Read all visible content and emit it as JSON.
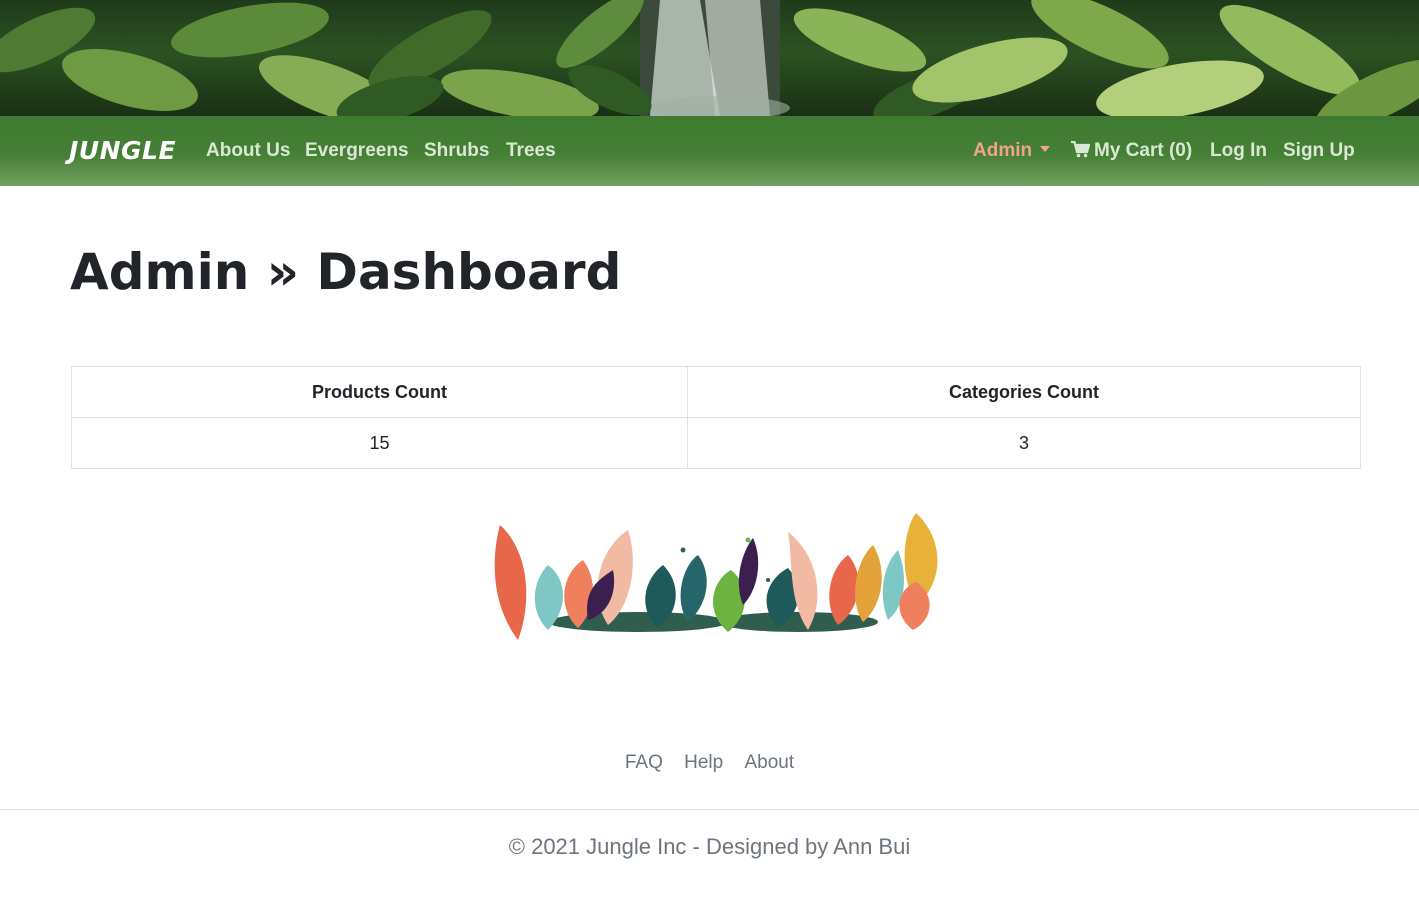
{
  "nav": {
    "brand": "JUNGLE",
    "links": [
      "About Us",
      "Evergreens",
      "Shrubs",
      "Trees"
    ],
    "admin_label": "Admin",
    "cart_label": "My Cart (0)",
    "login_label": "Log In",
    "signup_label": "Sign Up"
  },
  "page": {
    "title": "Admin » Dashboard"
  },
  "table": {
    "headers": [
      "Products Count",
      "Categories Count"
    ],
    "values": [
      "15",
      "3"
    ]
  },
  "footer": {
    "links": [
      "FAQ",
      "Help",
      "About"
    ],
    "copyright": "© 2021 Jungle Inc - Designed by Ann Bui"
  },
  "colors": {
    "nav_green": "#467f36",
    "nav_link": "#d9e8d2",
    "admin_accent": "#f0a48c",
    "text_dark": "#212529",
    "text_muted": "#6c757d",
    "border": "#dee2e6"
  },
  "icons": {
    "cart": "shopping-cart-icon",
    "dropdown": "caret-down-icon"
  }
}
